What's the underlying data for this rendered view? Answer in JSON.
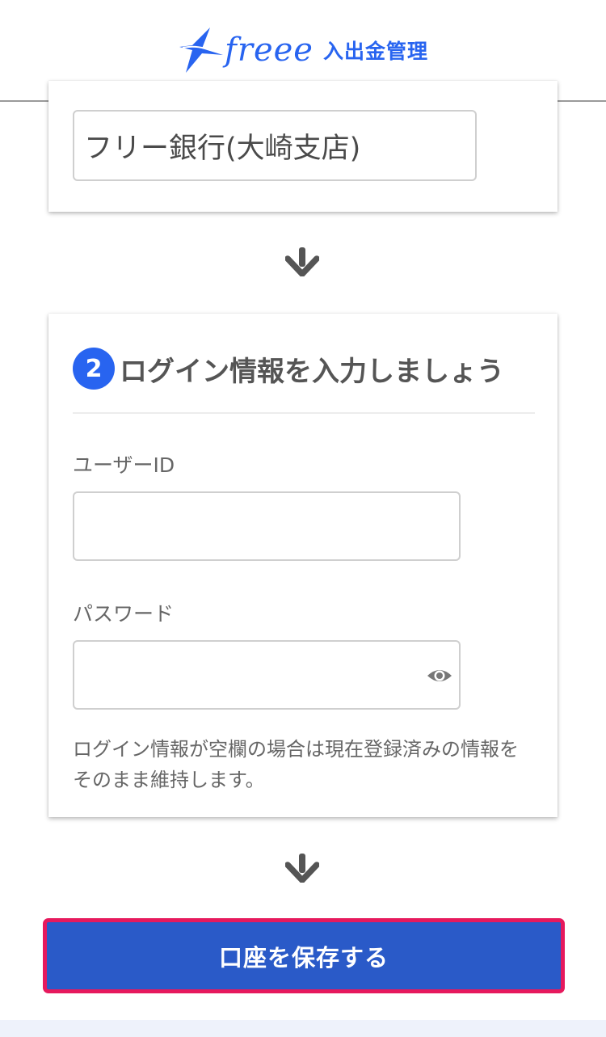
{
  "header": {
    "logo_word": "freee",
    "product_name": "入出金管理",
    "brand_color": "#2864f0"
  },
  "account": {
    "bank_value": "フリー銀行(大崎支店)"
  },
  "login_section": {
    "step_number": "2",
    "title": "ログイン情報を入力しましょう",
    "user_id_label": "ユーザーID",
    "user_id_value": "",
    "password_label": "パスワード",
    "password_value": "",
    "password_toggle_icon": "eye-icon",
    "note": "ログイン情報が空欄の場合は現在登録済みの情報をそのまま維持します。"
  },
  "actions": {
    "save_label": "口座を保存する",
    "button_color": "#2a5ac8",
    "highlight_color": "#e6195d"
  },
  "icons": {
    "flow_arrow": "arrow-down-icon"
  }
}
